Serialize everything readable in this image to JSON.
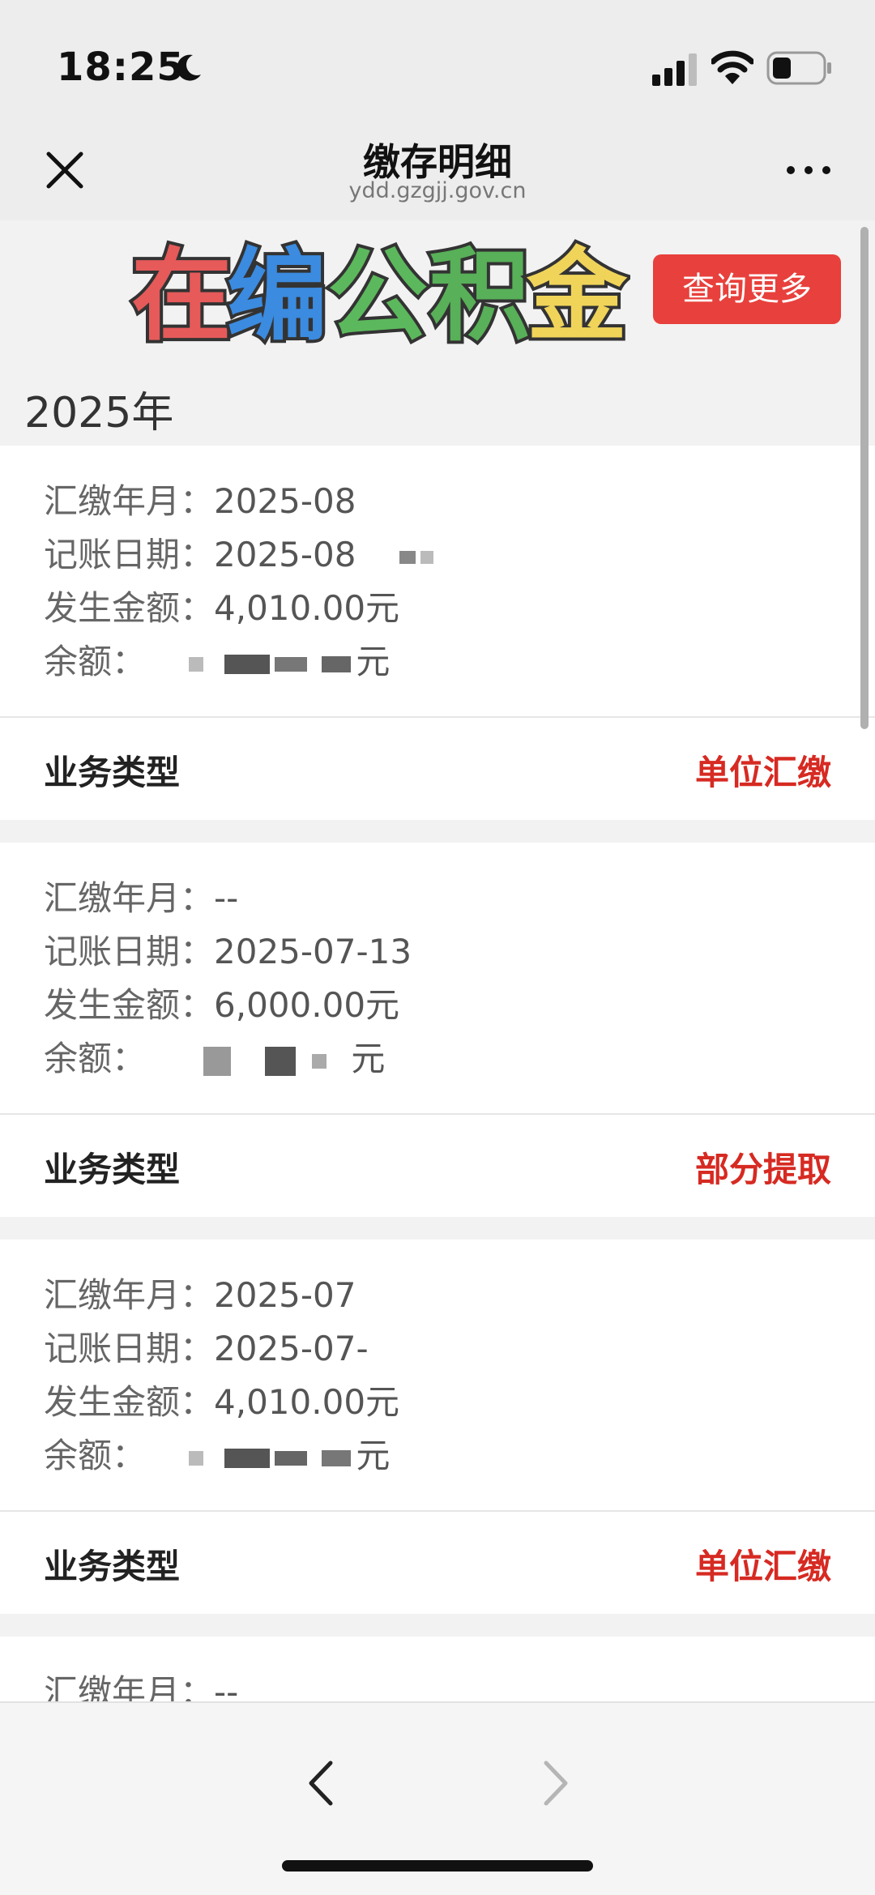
{
  "status_bar": {
    "time": "18:25"
  },
  "nav": {
    "title": "缴存明细",
    "domain": "ydd.gzgjj.gov.cn"
  },
  "banner": {
    "logo_text": "在编公积金",
    "query_more_label": "查询更多"
  },
  "year_heading": "2025年",
  "labels": {
    "pay_month": "汇缴年月：",
    "post_date": "记账日期：",
    "amount": "发生金额：",
    "balance": "余额：",
    "business_type": "业务类型",
    "yuan": "元"
  },
  "records": [
    {
      "pay_month": "2025-08",
      "post_date": "2025-08",
      "amount": "4,010.00元",
      "business_type": "单位汇缴"
    },
    {
      "pay_month": "--",
      "post_date": "2025-07-13",
      "amount": "6,000.00元",
      "business_type": "部分提取"
    },
    {
      "pay_month": "2025-07",
      "post_date": "2025-07-",
      "amount": "4,010.00元",
      "business_type": "单位汇缴"
    },
    {
      "pay_month": "--"
    }
  ],
  "colors": {
    "accent_red": "#e8403c",
    "type_red": "#d62a22"
  }
}
